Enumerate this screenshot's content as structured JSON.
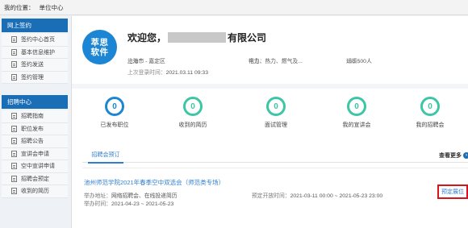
{
  "breadcrumb": {
    "label": "我的位置：",
    "current": "单位中心"
  },
  "sidebar": {
    "sections": [
      {
        "title": "网上签约",
        "items": [
          {
            "label": "签约中心首页"
          },
          {
            "label": "基本信息维护"
          },
          {
            "label": "签约发送"
          },
          {
            "label": "签约管理"
          }
        ]
      },
      {
        "title": "招聘中心",
        "items": [
          {
            "label": "招聘指南"
          },
          {
            "label": "职位发布"
          },
          {
            "label": "招聘公告"
          },
          {
            "label": "宣讲会申请"
          },
          {
            "label": "空中宣讲申请"
          },
          {
            "label": "招聘会预定"
          },
          {
            "label": "收到的简历"
          }
        ]
      }
    ]
  },
  "company": {
    "logo_line1": "萃思",
    "logo_line2": "软件",
    "welcome_prefix": "欢迎您，",
    "welcome_suffix": "有限公司",
    "address_label": "地址：",
    "address": "上海市 - 嘉定区",
    "industry_label": "行业：",
    "industry": "电力、热力、燃气及...",
    "scale_label": "规模：",
    "scale": "150-500人",
    "last_login_label": "上次登录时间：",
    "last_login": "2021.03.11 09:33"
  },
  "stats": [
    {
      "count": "0",
      "label": "已发布职位",
      "color": "#1d86d4"
    },
    {
      "count": "0",
      "label": "收到的简历",
      "color": "#3dc6a6"
    },
    {
      "count": "0",
      "label": "面试管理",
      "color": "#3dc6a6"
    },
    {
      "count": "0",
      "label": "我的宣讲会",
      "color": "#3dc6a6"
    },
    {
      "count": "0",
      "label": "我的招聘会",
      "color": "#3dc6a6"
    }
  ],
  "tabs": {
    "active": "招聘会预订",
    "see_more": "查看更多"
  },
  "fair": {
    "title": "池州师范学院2021年春季空中双选会（师范类专场）",
    "venue_label": "举办地址：",
    "venue": "网络招聘会、在线投递简历",
    "time_label": "举办时间：",
    "time": "2021-04-23 ~ 2021-05-23",
    "booking_label": "预定开放时间：",
    "booking": "2021-03-11 00:00 ~ 2021-05-23 23:00",
    "reserve_button": "预定展位"
  }
}
